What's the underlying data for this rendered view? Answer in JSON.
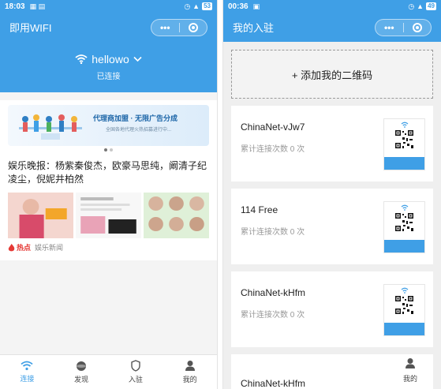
{
  "left": {
    "status": {
      "time": "18:03",
      "battery": "53"
    },
    "title": "即用WIFI",
    "wifi": {
      "ssid": "hellowo",
      "state": "已连接"
    },
    "banner": {
      "title": "代理商加盟 · 无限广告分成",
      "subtitle": "全国各地代理火热招募进行中..."
    },
    "news": {
      "headline": "娱乐晚报：杨紫秦俊杰，欧豪马思纯，阚清子纪凌尘，倪妮井柏然",
      "hot_tag": "热点",
      "source": "娱乐新闻"
    },
    "tabs": [
      {
        "label": "连接",
        "icon": "wifi-icon"
      },
      {
        "label": "发现",
        "icon": "discover-icon"
      },
      {
        "label": "入驻",
        "icon": "shield-icon"
      },
      {
        "label": "我的",
        "icon": "user-icon"
      }
    ]
  },
  "right": {
    "status": {
      "time": "00:36",
      "battery": "49"
    },
    "title": "我的入驻",
    "add_label": "+ 添加我的二维码",
    "entries": [
      {
        "name": "ChinaNet-vJw7",
        "count": "累计连接次数 0 次"
      },
      {
        "name": "114 Free",
        "count": "累计连接次数 0 次"
      },
      {
        "name": "ChinaNet-kHfm",
        "count": "累计连接次数 0 次"
      }
    ],
    "overlay_name": "ChinaNet-kHfm",
    "overlay_tab": "我的"
  },
  "colors": {
    "primary": "#3f9fe6",
    "hot": "#e53935"
  }
}
